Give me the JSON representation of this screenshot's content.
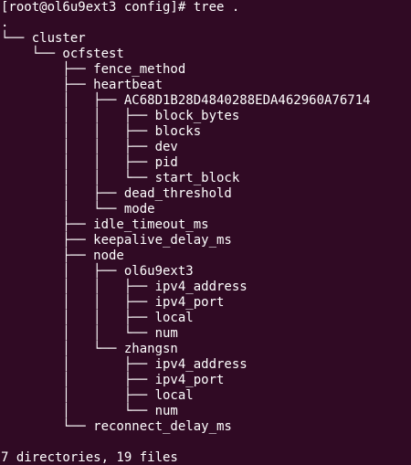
{
  "terminal": {
    "background_color": "#300a24",
    "text_color": "#ffffff",
    "prompt": "[root@ol6u9ext3 config]# ",
    "command": "tree .",
    "lines": [
      ".",
      "└── cluster",
      "    └── ocfstest",
      "        ├── fence_method",
      "        ├── heartbeat",
      "        │   ├── AC68D1B28D4840288EDA462960A76714",
      "        │   │   ├── block_bytes",
      "        │   │   ├── blocks",
      "        │   │   ├── dev",
      "        │   │   ├── pid",
      "        │   │   └── start_block",
      "        │   ├── dead_threshold",
      "        │   └── mode",
      "        ├── idle_timeout_ms",
      "        ├── keepalive_delay_ms",
      "        ├── node",
      "        │   ├── ol6u9ext3",
      "        │   │   ├── ipv4_address",
      "        │   │   ├── ipv4_port",
      "        │   │   ├── local",
      "        │   │   └── num",
      "        │   └── zhangsn",
      "        │       ├── ipv4_address",
      "        │       ├── ipv4_port",
      "        │       ├── local",
      "        │       └── num",
      "        └── reconnect_delay_ms",
      "",
      "7 directories, 19 files"
    ]
  }
}
